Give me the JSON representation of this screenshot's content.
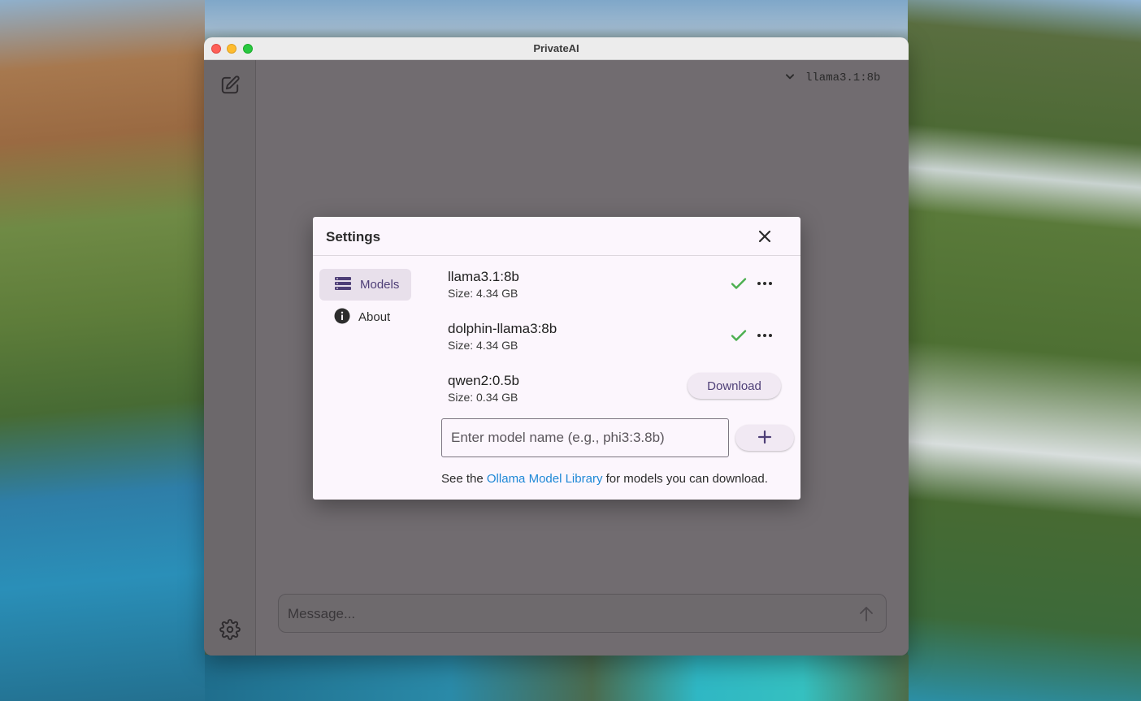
{
  "window": {
    "title": "PrivateAI"
  },
  "sidebar": {
    "icons": [
      "new-chat-icon",
      "gear-icon"
    ]
  },
  "header": {
    "selected_model": "llama3.1:8b"
  },
  "composer": {
    "placeholder": "Message..."
  },
  "settings": {
    "title": "Settings",
    "nav": [
      {
        "label": "Models",
        "icon": "list-icon",
        "active": true
      },
      {
        "label": "About",
        "icon": "info-icon",
        "active": false
      }
    ],
    "models": [
      {
        "name": "llama3.1:8b",
        "size": "Size: 4.34 GB",
        "status": "installed"
      },
      {
        "name": "dolphin-llama3:8b",
        "size": "Size: 4.34 GB",
        "status": "installed"
      },
      {
        "name": "qwen2:0.5b",
        "size": "Size: 0.34 GB",
        "status": "available",
        "action": "Download"
      }
    ],
    "model_input_placeholder": "Enter model name (e.g., phi3:3.8b)",
    "footer": {
      "prefix": "See the ",
      "link": "Ollama Model Library",
      "suffix": " for models you can download."
    }
  },
  "colors": {
    "accent": "#4e3f77",
    "check": "#4caf50",
    "link": "#1e88d6"
  }
}
